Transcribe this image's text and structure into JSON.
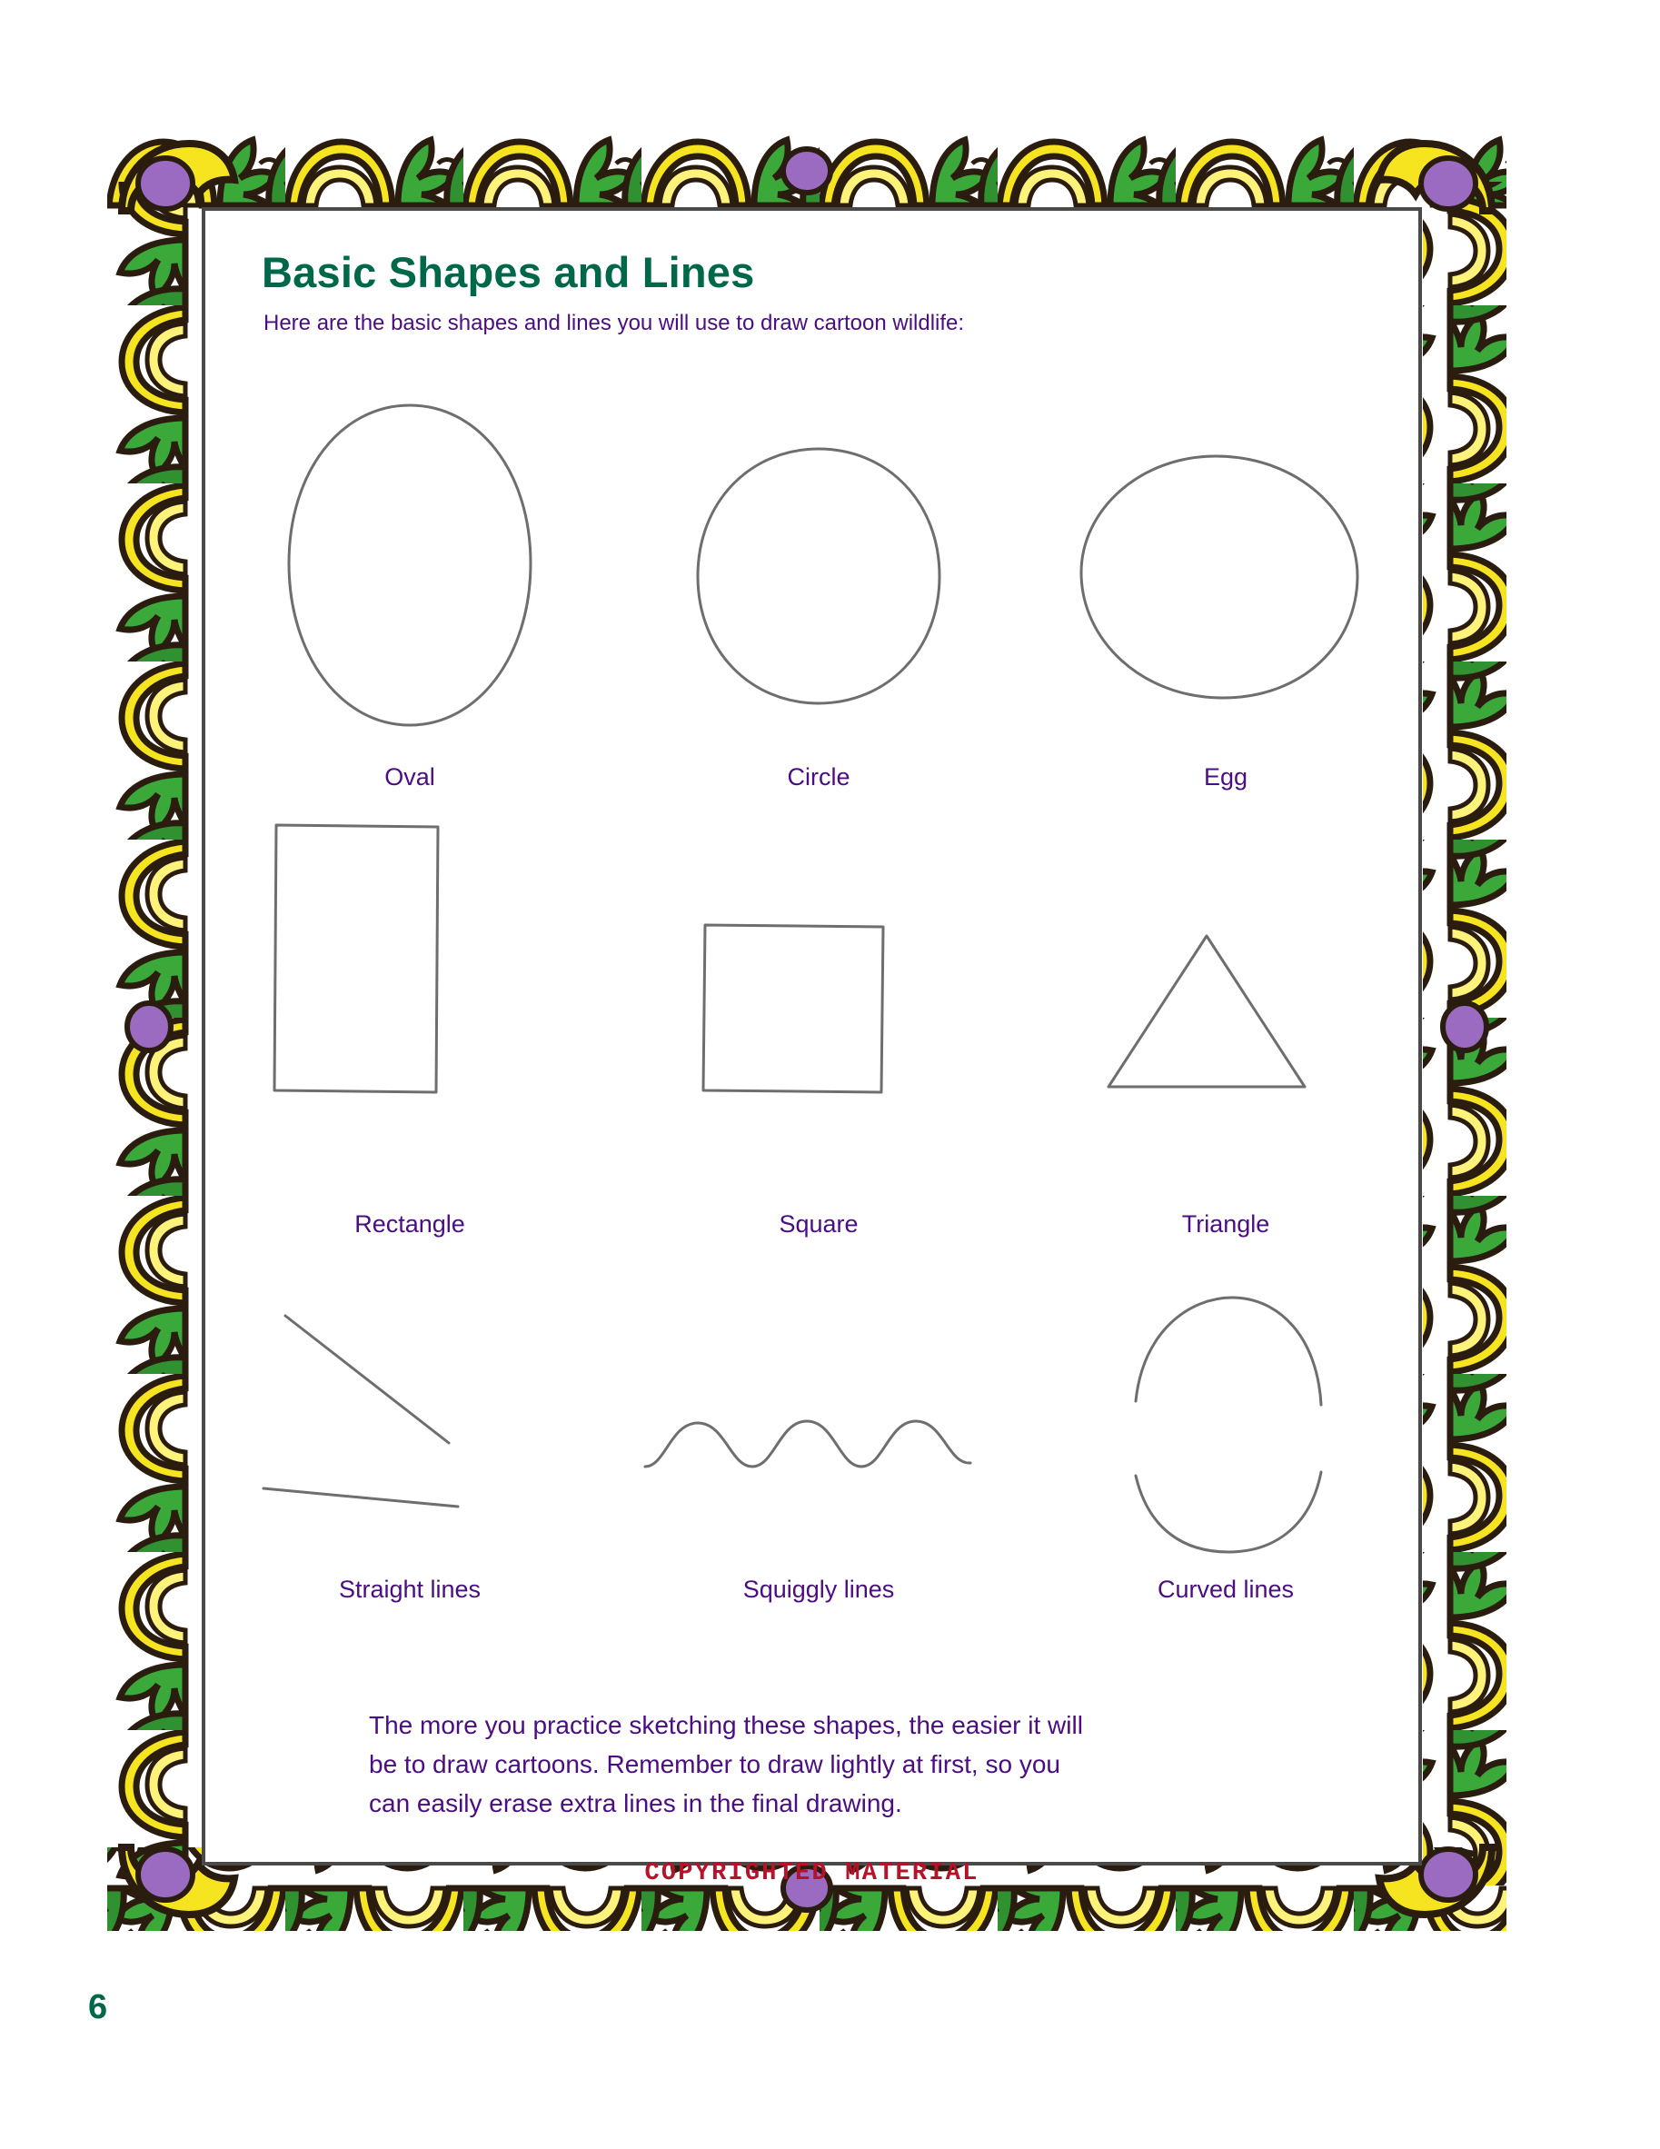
{
  "page": {
    "title": "Basic Shapes and Lines",
    "subtitle": "Here are the basic shapes and lines you will use to draw cartoon wildlife:",
    "page_number": "6",
    "copyright_stamp": "COPYRIGHTED MATERIAL",
    "title_color": "#00684a",
    "text_color": "#4b0d82",
    "stamp_color": "#b61229",
    "sketch_color": "#6e6e6e"
  },
  "border": {
    "style": "decorative-vine-ribbon",
    "ribbon_color": "#f5e41f",
    "leaf_color": "#3aa93a",
    "flower_color": "#9a6bc0",
    "outline_color": "#2b1c10"
  },
  "shapes": [
    {
      "id": "oval",
      "label": "Oval",
      "kind": "oval"
    },
    {
      "id": "circle",
      "label": "Circle",
      "kind": "circle"
    },
    {
      "id": "egg",
      "label": "Egg",
      "kind": "egg"
    },
    {
      "id": "rectangle",
      "label": "Rectangle",
      "kind": "rectangle"
    },
    {
      "id": "square",
      "label": "Square",
      "kind": "square"
    },
    {
      "id": "triangle",
      "label": "Triangle",
      "kind": "triangle"
    },
    {
      "id": "straight-lines",
      "label": "Straight lines",
      "kind": "straight-lines"
    },
    {
      "id": "squiggly-lines",
      "label": "Squiggly lines",
      "kind": "squiggly-lines"
    },
    {
      "id": "curved-lines",
      "label": "Curved lines",
      "kind": "curved-lines"
    }
  ],
  "closing_paragraph": {
    "line1": "The more you practice sketching these shapes, the easier it will",
    "line2": "be to draw cartoons. Remember to draw lightly at first, so you",
    "line3": "can easily erase extra lines in the final drawing."
  }
}
